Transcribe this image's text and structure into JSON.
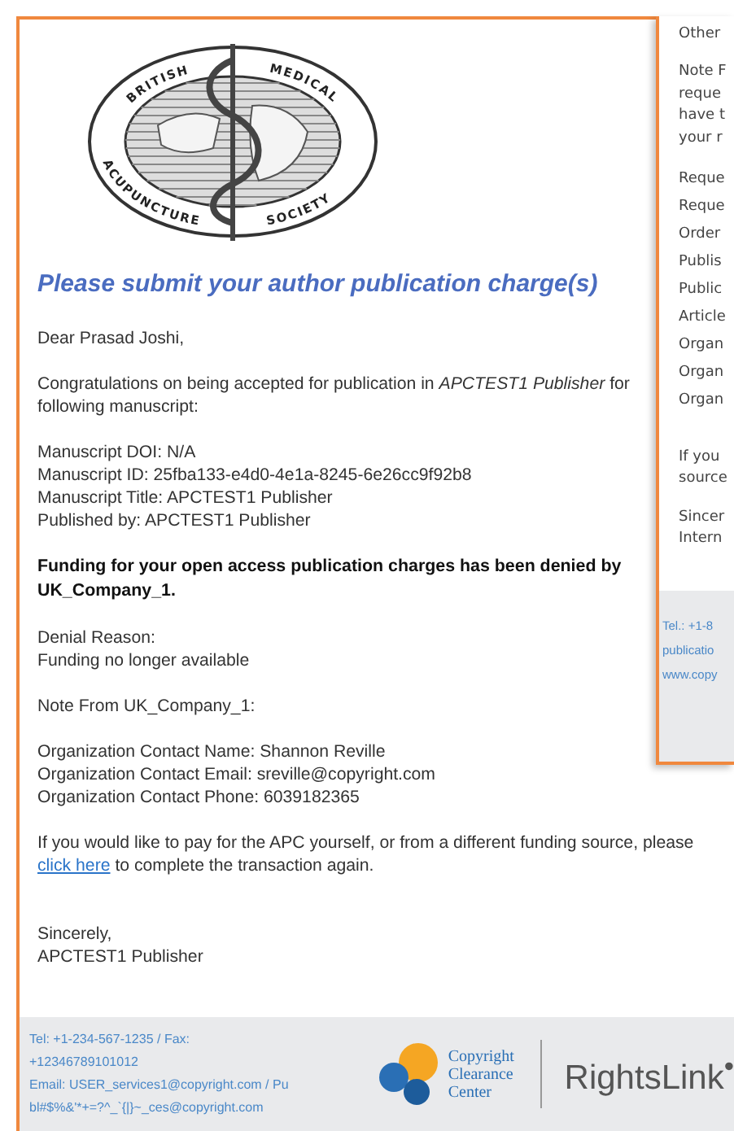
{
  "front_email": {
    "logo_text": [
      "BRITISH",
      "MEDICAL",
      "ACUPUNCTURE",
      "SOCIETY"
    ],
    "heading": "Please submit your author publication charge(s)",
    "blocks": [
      {
        "kind": "paragraph",
        "lines": [
          "Dear Prasad Joshi,"
        ]
      },
      {
        "kind": "paragraph",
        "lines": [
          "Congratulations on being accepted for publication in *APCTEST1 Publisher* for",
          "following manuscript:"
        ]
      },
      {
        "kind": "lines",
        "lines": [
          "Manuscript DOI: N/A",
          "Manuscript ID: 25fba133-e4d0-4e1a-8245-6e26cc9f92b8",
          "Manuscript Title: APCTEST1 Publisher",
          "Published by: APCTEST1 Publisher"
        ]
      },
      {
        "kind": "bold",
        "lines": [
          "Funding for your open access publication charges has been denied by",
          "UK_Company_1."
        ]
      },
      {
        "kind": "lines",
        "lines": [
          "Denial Reason:",
          "Funding no longer available"
        ]
      },
      {
        "kind": "lines",
        "lines": [
          "Note From UK_Company_1:"
        ]
      },
      {
        "kind": "lines",
        "lines": [
          "Organization Contact Name: Shannon Reville",
          "Organization Contact Email: sreville@copyright.com",
          "Organization Contact Phone: 6039182365"
        ]
      },
      {
        "kind": "link_paragraph",
        "lines": [
          "If you would like to pay for the APC yourself, or from a different funding source, please"
        ],
        "link": "click here",
        "after_link": "to complete the transaction again."
      },
      {
        "kind": "gap"
      },
      {
        "kind": "lines",
        "lines": [
          "Sincerely,",
          "APCTEST1 Publisher"
        ]
      }
    ],
    "footer": {
      "contact_lines": [
        "Tel: +1-234-567-1235 / Fax:",
        "+12346789101012",
        "Email: USER_services1@copyright.com / Pu",
        "bl#$%&'*+=?^_`{|}~_ces@copyright.com"
      ],
      "ccc_logo_lines": [
        "Copyright",
        "Clearance",
        "Center"
      ],
      "rightslink": "RightsLink$^{•}$"
    }
  },
  "back_email": {
    "lines": [
      {
        "kind": "text",
        "text": "Other"
      },
      {
        "kind": "space"
      },
      {
        "kind": "text",
        "text": "Note F"
      },
      {
        "kind": "text",
        "text": "reque"
      },
      {
        "kind": "text",
        "text": "have t"
      },
      {
        "kind": "text",
        "text": "your r"
      },
      {
        "kind": "space"
      },
      {
        "kind": "row",
        "text": "Reque"
      },
      {
        "kind": "row",
        "text": "Reque"
      },
      {
        "kind": "row",
        "text": "Order"
      },
      {
        "kind": "row",
        "text": "Publis"
      },
      {
        "kind": "row",
        "text": "Public"
      },
      {
        "kind": "row",
        "text": "Article"
      },
      {
        "kind": "row",
        "text": "Organ"
      },
      {
        "kind": "row",
        "text": "Organ"
      },
      {
        "kind": "row",
        "text": "Organ"
      },
      {
        "kind": "space"
      },
      {
        "kind": "space"
      },
      {
        "kind": "text",
        "text": "If you"
      },
      {
        "kind": "text",
        "text": "source"
      },
      {
        "kind": "space"
      },
      {
        "kind": "text",
        "text": "Sincer"
      },
      {
        "kind": "text",
        "text": "Intern"
      }
    ],
    "footer_lines": [
      "Tel.: +1-8",
      "publicatio",
      "www.copy"
    ]
  }
}
